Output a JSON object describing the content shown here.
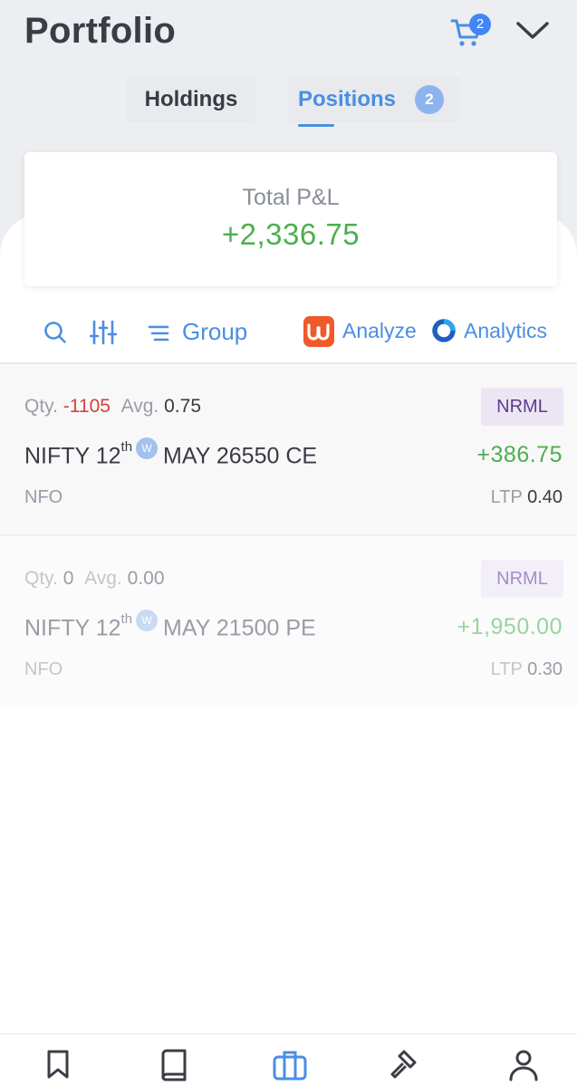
{
  "header": {
    "title": "Portfolio",
    "cart_count": "2"
  },
  "tabs": [
    {
      "label": "Holdings",
      "active": false
    },
    {
      "label": "Positions",
      "badge": "2",
      "active": true
    }
  ],
  "summary": {
    "label": "Total P&L",
    "value": "+2,336.75"
  },
  "toolbar": {
    "group_label": "Group",
    "analyze_label": "Analyze",
    "analytics_label": "Analytics"
  },
  "positions": [
    {
      "qty_label": "Qty.",
      "qty": "-1105",
      "avg_label": "Avg.",
      "avg": "0.75",
      "product": "NRML",
      "symbol": "NIFTY 12",
      "suffix": "th",
      "weekly": "W",
      "expiry": "MAY 26550 CE",
      "pnl": "+386.75",
      "exchange": "NFO",
      "ltp_label": "LTP",
      "ltp": "0.40"
    },
    {
      "qty_label": "Qty.",
      "qty": "0",
      "avg_label": "Avg.",
      "avg": "0.00",
      "product": "NRML",
      "symbol": "NIFTY 12",
      "suffix": "th",
      "weekly": "W",
      "expiry": "MAY 21500 PE",
      "pnl": "+1,950.00",
      "exchange": "NFO",
      "ltp_label": "LTP",
      "ltp": "0.30"
    }
  ],
  "colors": {
    "accent": "#4a8ee3",
    "positive": "#4caf50",
    "negative": "#d0453b",
    "analyze_brand": "#f05a2a"
  },
  "bottom_nav": [
    "bookmark-icon",
    "orderbook-icon",
    "portfolio-icon",
    "bids-icon",
    "profile-icon"
  ]
}
